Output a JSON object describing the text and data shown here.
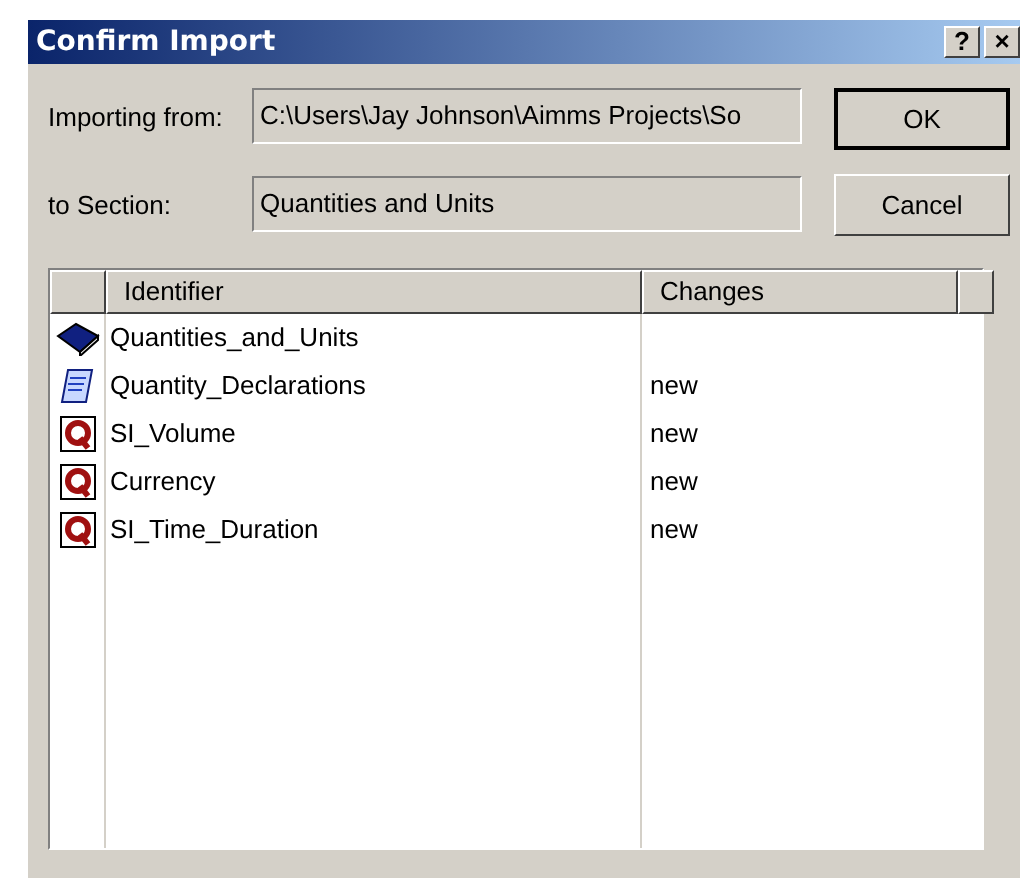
{
  "window": {
    "title": "Confirm Import",
    "title_buttons": [
      "?",
      "×"
    ]
  },
  "fields": [
    {
      "label": "Importing from:",
      "value": "C:\\Users\\Jay Johnson\\Aimms Projects\\So"
    },
    {
      "label": "to Section:",
      "value": "Quantities and Units"
    }
  ],
  "buttons": [
    "OK",
    "Cancel"
  ],
  "table": {
    "columns": [
      "Identifier",
      "Changes"
    ],
    "rows": [
      {
        "kind": "section",
        "identifier": "Quantities_and_Units"
      },
      {
        "kind": "declaration",
        "identifier": "Quantity_Declarations",
        "changes": "new"
      },
      {
        "kind": "quantity",
        "identifier": "SI_Volume",
        "changes": "new"
      },
      {
        "kind": "quantity",
        "identifier": "Currency",
        "changes": "new"
      },
      {
        "kind": "quantity",
        "identifier": "SI_Time_Duration",
        "changes": "new"
      }
    ]
  }
}
